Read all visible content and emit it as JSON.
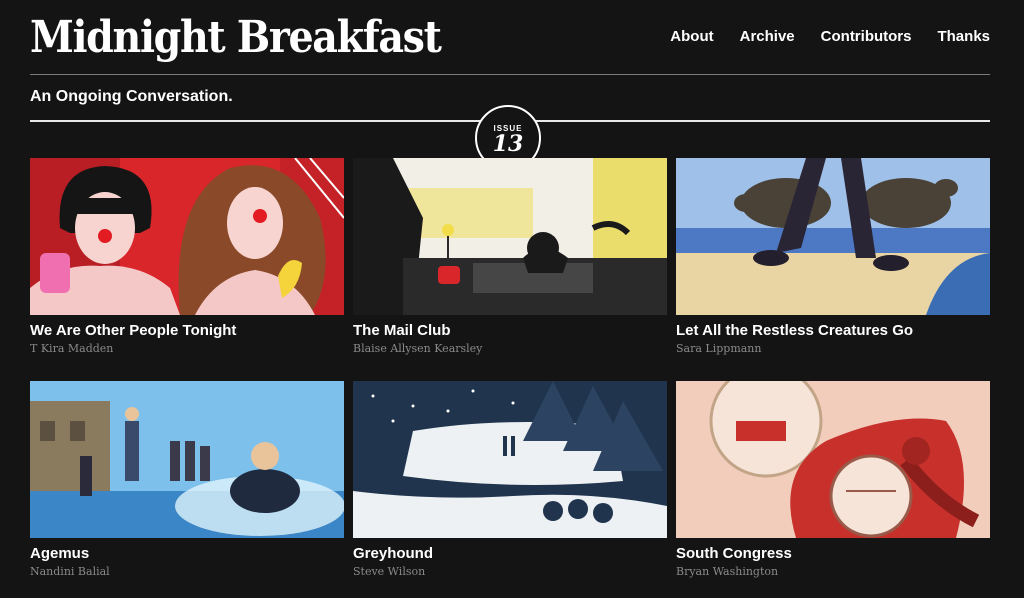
{
  "site": {
    "title": "Midnight Breakfast",
    "tagline": "An Ongoing Conversation."
  },
  "nav": {
    "items": [
      "About",
      "Archive",
      "Contributors",
      "Thanks"
    ]
  },
  "issue": {
    "label": "ISSUE",
    "number": "13"
  },
  "stories": [
    {
      "title": "We Are Other People Tonight",
      "author": "T Kira Madden"
    },
    {
      "title": "The Mail Club",
      "author": "Blaise Allysen Kearsley"
    },
    {
      "title": "Let All the Restless Creatures Go",
      "author": "Sara Lippmann"
    },
    {
      "title": "Agemus",
      "author": "Nandini Balial"
    },
    {
      "title": "Greyhound",
      "author": "Steve Wilson"
    },
    {
      "title": "South Congress",
      "author": "Bryan Washington"
    }
  ]
}
